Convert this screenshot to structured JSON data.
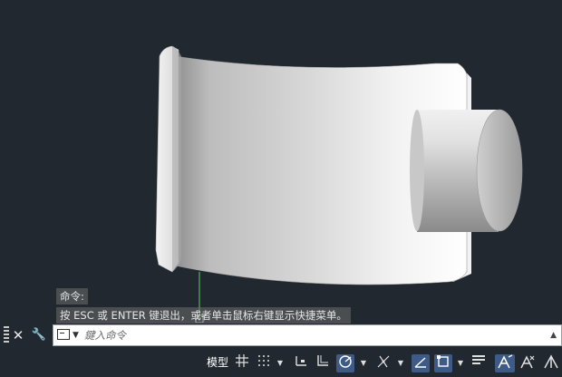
{
  "history": {
    "line1": "命令:",
    "line2": "按 ESC 或 ENTER 键退出，或者单击鼠标右键显示快捷菜单。"
  },
  "command": {
    "placeholder": "鍵入命令",
    "close_glyph": "✕",
    "tool_glyph": "🔧",
    "dropdown_glyph": "▼",
    "up_glyph": "▲"
  },
  "statusbar": {
    "model_label": "模型",
    "icons": [
      "grid-display-icon",
      "snap-mode-icon",
      "infer-constraints-icon",
      "ortho-mode-icon",
      "polar-tracking-icon",
      "isodraft-icon",
      "object-snap-tracking-icon",
      "object-snap-icon",
      "lineweight-icon",
      "annotation-visibility-icon",
      "autoscale-icon",
      "annotation-scale-icon"
    ]
  },
  "colors": {
    "viewport_bg": "#212830",
    "input_bg": "#ffffff",
    "active_toggle": "#3d5b86",
    "crosshair": "#66cc66"
  }
}
